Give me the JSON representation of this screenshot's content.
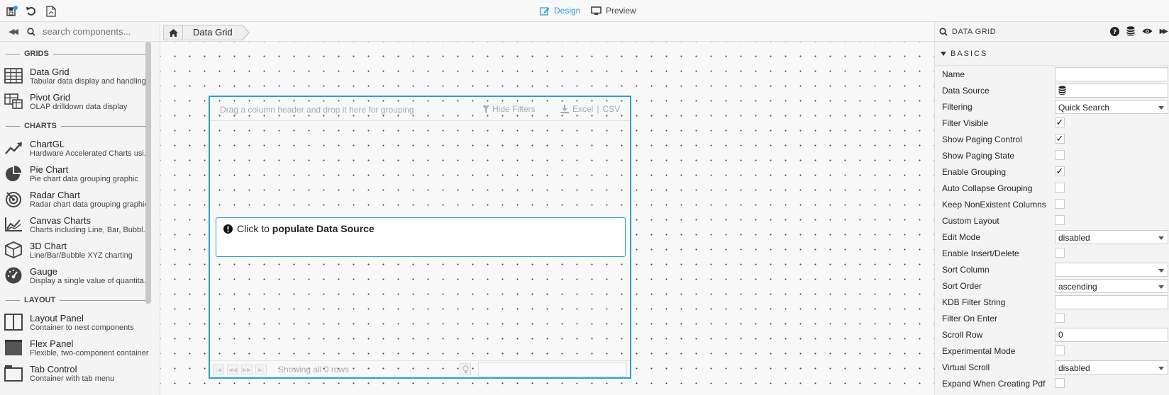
{
  "toolbar": {
    "design_label": "Design",
    "preview_label": "Preview"
  },
  "left_panel": {
    "search_placeholder": "search components...",
    "sections": [
      {
        "title": "GRIDS",
        "items": [
          {
            "name": "Data Grid",
            "desc": "Tabular data display and handling",
            "icon": "table-icon"
          },
          {
            "name": "Pivot Grid",
            "desc": "OLAP drilldown data display",
            "icon": "pivot-icon"
          }
        ]
      },
      {
        "title": "CHARTS",
        "items": [
          {
            "name": "ChartGL",
            "desc": "Hardware Accelerated Charts usi...",
            "icon": "trend-icon"
          },
          {
            "name": "Pie Chart",
            "desc": "Pie chart data grouping graphic",
            "icon": "pie-icon"
          },
          {
            "name": "Radar Chart",
            "desc": "Radar chart data grouping graphic",
            "icon": "radar-icon"
          },
          {
            "name": "Canvas Charts",
            "desc": "Charts including Line, Bar, Bubbl...",
            "icon": "area-chart-icon"
          },
          {
            "name": "3D Chart",
            "desc": "Line/Bar/Bubble XYZ charting",
            "icon": "cube-icon"
          },
          {
            "name": "Gauge",
            "desc": "Display a single value of quantita...",
            "icon": "gauge-icon"
          }
        ]
      },
      {
        "title": "LAYOUT",
        "items": [
          {
            "name": "Layout Panel",
            "desc": "Container to nest components",
            "icon": "layout-icon"
          },
          {
            "name": "Flex Panel",
            "desc": "Flexible, two-component container",
            "icon": "flex-icon"
          },
          {
            "name": "Tab Control",
            "desc": "Container with tab menu",
            "icon": "tab-icon"
          }
        ]
      }
    ]
  },
  "breadcrumb": {
    "current": "Data Grid"
  },
  "grid_widget": {
    "drop_hint": "Drag a column header and drop it here for grouping",
    "hide_filters": "Hide Filters",
    "excel": "Excel",
    "separator": "|",
    "csv": "CSV",
    "populate_prefix": "Click to",
    "populate_bold": "populate Data Source",
    "rows_text": "Showing all 0 rows"
  },
  "right_panel": {
    "title": "DATA GRID",
    "section": "BASICS",
    "properties": [
      {
        "label": "Name",
        "type": "input",
        "value": ""
      },
      {
        "label": "Data Source",
        "type": "datasource",
        "value": ""
      },
      {
        "label": "Filtering",
        "type": "select",
        "value": "Quick Search"
      },
      {
        "label": "Filter Visible",
        "type": "check",
        "checked": true
      },
      {
        "label": "Show Paging Control",
        "type": "check",
        "checked": true
      },
      {
        "label": "Show Paging State",
        "type": "check",
        "checked": false
      },
      {
        "label": "Enable Grouping",
        "type": "check",
        "checked": true
      },
      {
        "label": "Auto Collapse Grouping",
        "type": "check",
        "checked": false
      },
      {
        "label": "Keep NonExistent Columns",
        "type": "check",
        "checked": false
      },
      {
        "label": "Custom Layout",
        "type": "check",
        "checked": false
      },
      {
        "label": "Edit Mode",
        "type": "select",
        "value": "disabled"
      },
      {
        "label": "Enable Insert/Delete",
        "type": "check",
        "checked": false
      },
      {
        "label": "Sort Column",
        "type": "select",
        "value": ""
      },
      {
        "label": "Sort Order",
        "type": "select",
        "value": "ascending"
      },
      {
        "label": "KDB Filter String",
        "type": "input",
        "value": ""
      },
      {
        "label": "Filter On Enter",
        "type": "check",
        "checked": false
      },
      {
        "label": "Scroll Row",
        "type": "input",
        "value": "0"
      },
      {
        "label": "Experimental Mode",
        "type": "check",
        "checked": false
      },
      {
        "label": "Virtual Scroll",
        "type": "select",
        "value": "disabled"
      },
      {
        "label": "Expand When Creating Pdf",
        "type": "check",
        "checked": false
      }
    ]
  },
  "colors": {
    "accent": "#2a9fd6"
  }
}
